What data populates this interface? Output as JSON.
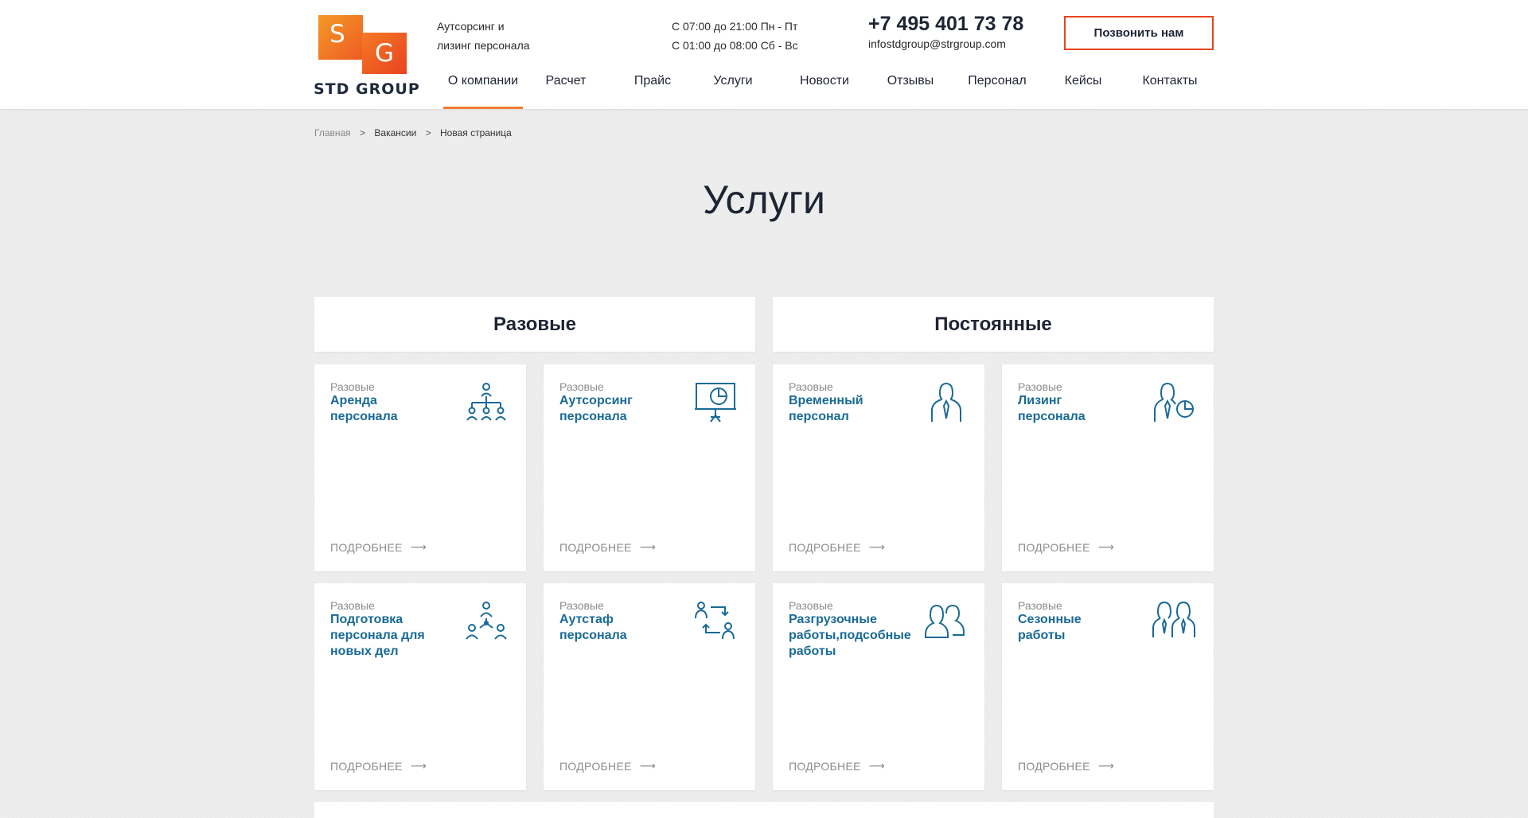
{
  "brand": {
    "letter_s": "S",
    "letter_g": "G",
    "name": "STD GROUP"
  },
  "header": {
    "tagline_line1": "Аутсорсинг и",
    "tagline_line2": "лизинг персонала",
    "hours_line1": "С 07:00 до 21:00 Пн - Пт",
    "hours_line2": "С 01:00 до 08:00 Сб - Вс",
    "phone": "+7 495 401 73 78",
    "email": "infostdgroup@strgroup.com",
    "call_button": "Позвонить нам"
  },
  "nav": [
    {
      "label": "О компании",
      "active": true
    },
    {
      "label": "Расчет"
    },
    {
      "label": "Прайс"
    },
    {
      "label": "Услуги"
    },
    {
      "label": "Новости"
    },
    {
      "label": "Отзывы"
    },
    {
      "label": "Персонал"
    },
    {
      "label": "Кейсы"
    },
    {
      "label": "Контакты"
    }
  ],
  "breadcrumb": {
    "home": "Главная",
    "sep": ">",
    "level2": "Вакансии",
    "current": "Новая страница"
  },
  "page_title": "Услуги",
  "columns": {
    "left": "Разовые",
    "right": "Постоянные"
  },
  "cards": [
    {
      "category": "Разовые",
      "title": "Аренда персонала",
      "icon": "org-chart-icon",
      "more": "ПОДРОБНЕЕ"
    },
    {
      "category": "Разовые",
      "title": "Аутсорсинг персонала",
      "icon": "presentation-board-icon",
      "more": "ПОДРОБНЕЕ"
    },
    {
      "category": "Разовые",
      "title": "Временный персонал",
      "icon": "person-tie-icon",
      "more": "ПОДРОБНЕЕ"
    },
    {
      "category": "Разовые",
      "title": "Лизинг персонала",
      "icon": "person-pie-chart-icon",
      "more": "ПОДРОБНЕЕ"
    },
    {
      "category": "Разовые",
      "title": "Подготовка персонала для новых дел",
      "icon": "team-network-icon",
      "more": "ПОДРОБНЕЕ"
    },
    {
      "category": "Разовые",
      "title": "Аутстаф персонала",
      "icon": "people-exchange-icon",
      "more": "ПОДРОБНЕЕ"
    },
    {
      "category": "Разовые",
      "title": "Разгрузочные работы,подсобные работы",
      "icon": "two-people-icon",
      "more": "ПОДРОБНЕЕ"
    },
    {
      "category": "Разовые",
      "title": "Сезонные работы",
      "icon": "business-pair-icon",
      "more": "ПОДРОБНЕЕ"
    }
  ],
  "colors": {
    "accent": "#f07a2d",
    "button_border": "#e8431f",
    "link": "#1a6a96",
    "icon": "#1a6a96"
  }
}
